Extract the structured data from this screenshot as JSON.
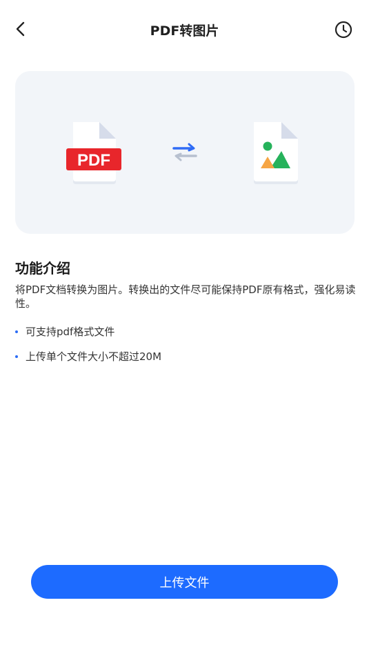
{
  "header": {
    "title": "PDF转图片",
    "back_icon": "chevron-left-icon",
    "history_icon": "clock-icon"
  },
  "banner": {
    "source_badge": "PDF",
    "swap_icon": "swap-arrows-icon",
    "target_icon": "image-file-icon",
    "colors": {
      "pdf_red": "#e8262b",
      "arrow_blue": "#2f6cf6",
      "green": "#26b25b",
      "orange": "#f6a544"
    }
  },
  "intro": {
    "title": "功能介绍",
    "description": "将PDF文档转换为图片。转换出的文件尽可能保持PDF原有格式，强化易读性。",
    "bullets": [
      "可支持pdf格式文件",
      "上传单个文件大小不超过20M"
    ]
  },
  "action": {
    "upload_label": "上传文件",
    "accent": "#1d6bff"
  }
}
